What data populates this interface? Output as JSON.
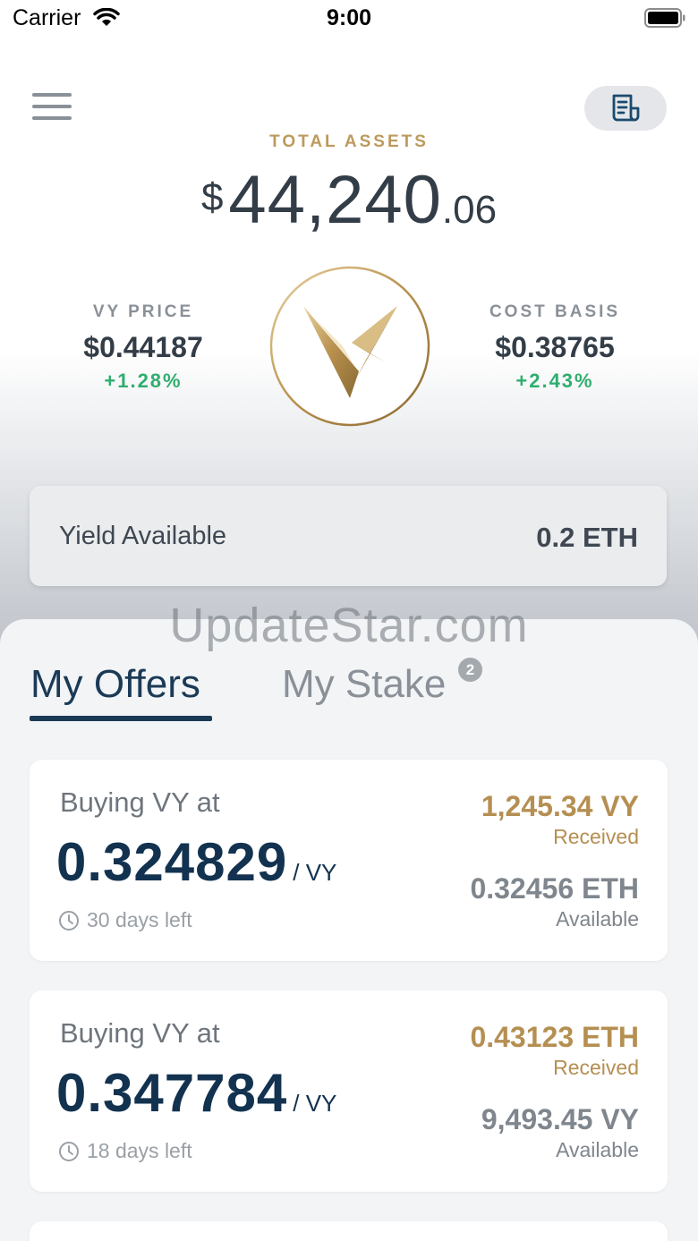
{
  "status_bar": {
    "carrier": "Carrier",
    "time": "9:00"
  },
  "header": {
    "total_label": "TOTAL ASSETS",
    "total_currency": "$",
    "total_integer": "44,240",
    "total_decimal": ".06"
  },
  "vy_price": {
    "label": "VY PRICE",
    "value": "$0.44187",
    "change": "+1.28%"
  },
  "cost_basis": {
    "label": "COST BASIS",
    "value": "$0.38765",
    "change": "+2.43%"
  },
  "yield": {
    "label": "Yield Available",
    "value": "0.2 ETH"
  },
  "watermark": "UpdateStar.com",
  "tabs": {
    "offers": "My Offers",
    "stake": "My Stake",
    "stake_badge": "2"
  },
  "offers": [
    {
      "title": "Buying VY at",
      "rate": "0.324829",
      "unit": "/ VY",
      "days": "30 days left",
      "received_amount": "1,245.34 VY",
      "received_label": "Received",
      "available_amount": "0.32456 ETH",
      "available_label": "Available"
    },
    {
      "title": "Buying VY at",
      "rate": "0.347784",
      "unit": "/ VY",
      "days": "18 days left",
      "received_amount": "0.43123 ETH",
      "received_label": "Received",
      "available_amount": "9,493.45 VY",
      "available_label": "Available"
    }
  ],
  "colors": {
    "gold": "#bc9a5c",
    "navy": "#1b3a56",
    "green": "#2fae6e",
    "gray": "#8a9097"
  }
}
